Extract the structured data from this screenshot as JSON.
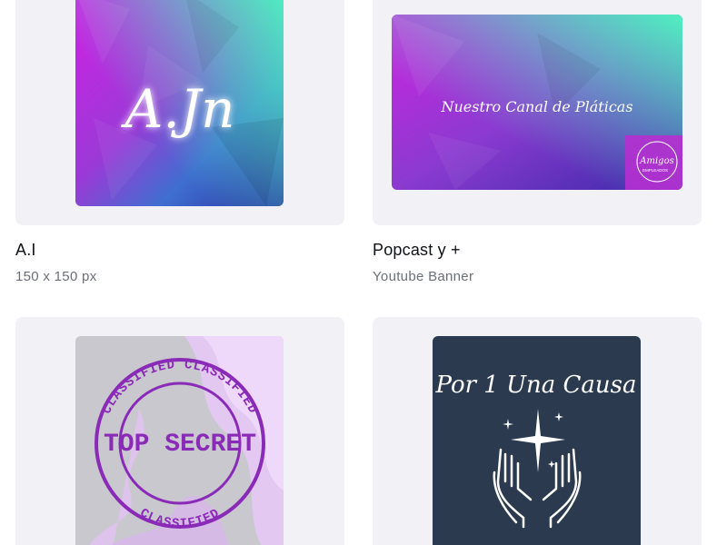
{
  "designs": [
    {
      "title": "A.I",
      "subtitle": "150 x 150 px",
      "thumbnail_text": "A.Jn"
    },
    {
      "title": "Popcast y +",
      "subtitle": "Youtube Banner",
      "thumbnail_text": "Nuestro Canal de Pláticas",
      "thumbnail_badge": "Amigos",
      "thumbnail_badge_sub": "EMPLEADOS"
    },
    {
      "thumbnail_stamp_ring": "CLASSIFIED CLASSIFIED",
      "thumbnail_stamp_ring_bottom": "CLASSIFIED",
      "thumbnail_stamp_main": "TOP SECRET"
    },
    {
      "thumbnail_text": "Por 1 Una Causa"
    }
  ],
  "colors": {
    "card_bg": "#f1f1f6",
    "title": "#0e1318",
    "subtitle": "#6b6f76",
    "gradient_magenta": "#c21ee0",
    "gradient_teal": "#3ee6b8",
    "gradient_blue": "#3a2aa8",
    "stamp_purple": "#8a2bb8",
    "causa_bg": "#2b3a4f"
  }
}
